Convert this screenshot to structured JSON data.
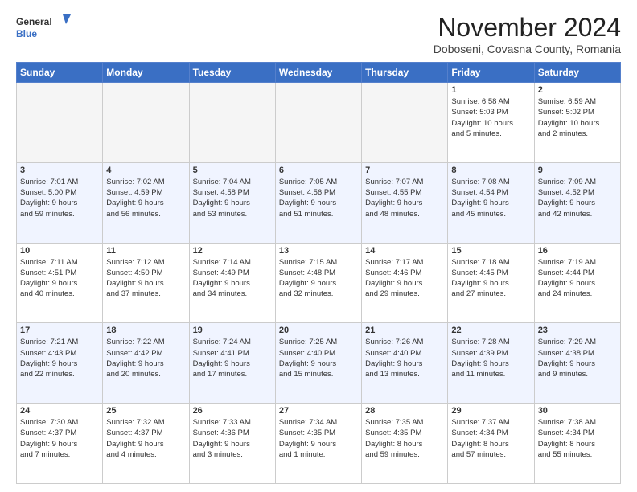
{
  "header": {
    "logo_general": "General",
    "logo_blue": "Blue",
    "month_title": "November 2024",
    "location": "Doboseni, Covasna County, Romania"
  },
  "days_of_week": [
    "Sunday",
    "Monday",
    "Tuesday",
    "Wednesday",
    "Thursday",
    "Friday",
    "Saturday"
  ],
  "weeks": [
    [
      {
        "day": "",
        "info": ""
      },
      {
        "day": "",
        "info": ""
      },
      {
        "day": "",
        "info": ""
      },
      {
        "day": "",
        "info": ""
      },
      {
        "day": "",
        "info": ""
      },
      {
        "day": "1",
        "info": "Sunrise: 6:58 AM\nSunset: 5:03 PM\nDaylight: 10 hours\nand 5 minutes."
      },
      {
        "day": "2",
        "info": "Sunrise: 6:59 AM\nSunset: 5:02 PM\nDaylight: 10 hours\nand 2 minutes."
      }
    ],
    [
      {
        "day": "3",
        "info": "Sunrise: 7:01 AM\nSunset: 5:00 PM\nDaylight: 9 hours\nand 59 minutes."
      },
      {
        "day": "4",
        "info": "Sunrise: 7:02 AM\nSunset: 4:59 PM\nDaylight: 9 hours\nand 56 minutes."
      },
      {
        "day": "5",
        "info": "Sunrise: 7:04 AM\nSunset: 4:58 PM\nDaylight: 9 hours\nand 53 minutes."
      },
      {
        "day": "6",
        "info": "Sunrise: 7:05 AM\nSunset: 4:56 PM\nDaylight: 9 hours\nand 51 minutes."
      },
      {
        "day": "7",
        "info": "Sunrise: 7:07 AM\nSunset: 4:55 PM\nDaylight: 9 hours\nand 48 minutes."
      },
      {
        "day": "8",
        "info": "Sunrise: 7:08 AM\nSunset: 4:54 PM\nDaylight: 9 hours\nand 45 minutes."
      },
      {
        "day": "9",
        "info": "Sunrise: 7:09 AM\nSunset: 4:52 PM\nDaylight: 9 hours\nand 42 minutes."
      }
    ],
    [
      {
        "day": "10",
        "info": "Sunrise: 7:11 AM\nSunset: 4:51 PM\nDaylight: 9 hours\nand 40 minutes."
      },
      {
        "day": "11",
        "info": "Sunrise: 7:12 AM\nSunset: 4:50 PM\nDaylight: 9 hours\nand 37 minutes."
      },
      {
        "day": "12",
        "info": "Sunrise: 7:14 AM\nSunset: 4:49 PM\nDaylight: 9 hours\nand 34 minutes."
      },
      {
        "day": "13",
        "info": "Sunrise: 7:15 AM\nSunset: 4:48 PM\nDaylight: 9 hours\nand 32 minutes."
      },
      {
        "day": "14",
        "info": "Sunrise: 7:17 AM\nSunset: 4:46 PM\nDaylight: 9 hours\nand 29 minutes."
      },
      {
        "day": "15",
        "info": "Sunrise: 7:18 AM\nSunset: 4:45 PM\nDaylight: 9 hours\nand 27 minutes."
      },
      {
        "day": "16",
        "info": "Sunrise: 7:19 AM\nSunset: 4:44 PM\nDaylight: 9 hours\nand 24 minutes."
      }
    ],
    [
      {
        "day": "17",
        "info": "Sunrise: 7:21 AM\nSunset: 4:43 PM\nDaylight: 9 hours\nand 22 minutes."
      },
      {
        "day": "18",
        "info": "Sunrise: 7:22 AM\nSunset: 4:42 PM\nDaylight: 9 hours\nand 20 minutes."
      },
      {
        "day": "19",
        "info": "Sunrise: 7:24 AM\nSunset: 4:41 PM\nDaylight: 9 hours\nand 17 minutes."
      },
      {
        "day": "20",
        "info": "Sunrise: 7:25 AM\nSunset: 4:40 PM\nDaylight: 9 hours\nand 15 minutes."
      },
      {
        "day": "21",
        "info": "Sunrise: 7:26 AM\nSunset: 4:40 PM\nDaylight: 9 hours\nand 13 minutes."
      },
      {
        "day": "22",
        "info": "Sunrise: 7:28 AM\nSunset: 4:39 PM\nDaylight: 9 hours\nand 11 minutes."
      },
      {
        "day": "23",
        "info": "Sunrise: 7:29 AM\nSunset: 4:38 PM\nDaylight: 9 hours\nand 9 minutes."
      }
    ],
    [
      {
        "day": "24",
        "info": "Sunrise: 7:30 AM\nSunset: 4:37 PM\nDaylight: 9 hours\nand 7 minutes."
      },
      {
        "day": "25",
        "info": "Sunrise: 7:32 AM\nSunset: 4:37 PM\nDaylight: 9 hours\nand 4 minutes."
      },
      {
        "day": "26",
        "info": "Sunrise: 7:33 AM\nSunset: 4:36 PM\nDaylight: 9 hours\nand 3 minutes."
      },
      {
        "day": "27",
        "info": "Sunrise: 7:34 AM\nSunset: 4:35 PM\nDaylight: 9 hours\nand 1 minute."
      },
      {
        "day": "28",
        "info": "Sunrise: 7:35 AM\nSunset: 4:35 PM\nDaylight: 8 hours\nand 59 minutes."
      },
      {
        "day": "29",
        "info": "Sunrise: 7:37 AM\nSunset: 4:34 PM\nDaylight: 8 hours\nand 57 minutes."
      },
      {
        "day": "30",
        "info": "Sunrise: 7:38 AM\nSunset: 4:34 PM\nDaylight: 8 hours\nand 55 minutes."
      }
    ]
  ]
}
